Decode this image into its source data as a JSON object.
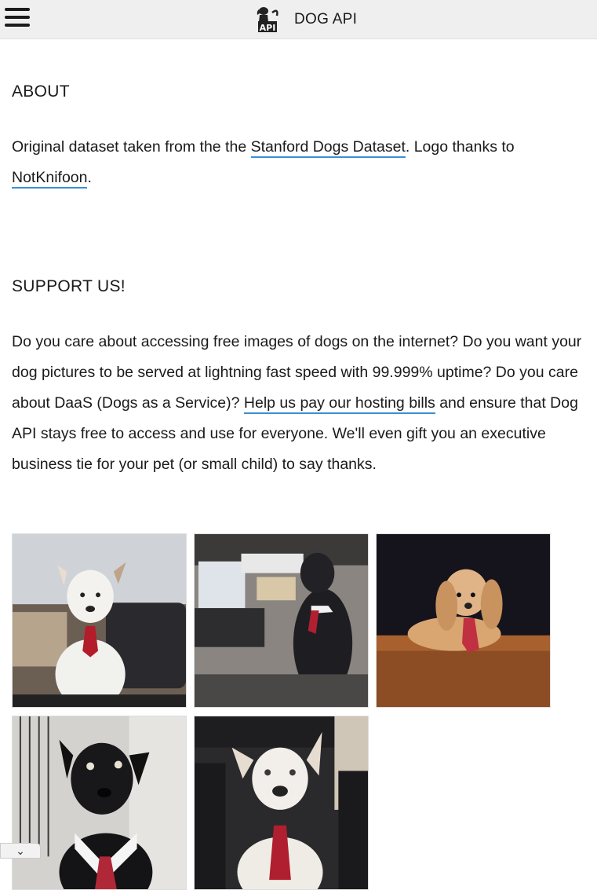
{
  "header": {
    "menu_icon": "hamburger-menu-icon",
    "logo_icon": "dog-api-logo-icon",
    "brand_name": "DOG API"
  },
  "about": {
    "heading": "ABOUT",
    "text_1": "Original dataset taken from the the ",
    "link_stanford": "Stanford Dogs Dataset",
    "text_2": ". Logo thanks to ",
    "link_notknifoon": "NotKnifoon",
    "text_3": "."
  },
  "support": {
    "heading": "SUPPORT US!",
    "text_1": "Do you care about accessing free images of dogs on the internet? Do you want your dog pictures to be served at lightning fast speed with 99.999% uptime? Do you care about DaaS (Dogs as a Service)? ",
    "link_help": "Help us pay our hosting bills",
    "text_2": " and ensure that Dog API stays free to access and use for everyone. We'll even gift you an executive business tie for your pet (or small child) to say thanks."
  },
  "gallery": {
    "images": [
      {
        "subject": "white dog with red tie on leather sofa"
      },
      {
        "subject": "black dog with tie beside laptop and keyboard"
      },
      {
        "subject": "long-haired dachshund with tie on wooden floor"
      },
      {
        "subject": "black dog with white collar and tie"
      },
      {
        "subject": "white dog with tie on black leather chair"
      }
    ]
  },
  "footer": {
    "chevron_icon": "chevron-down-icon"
  },
  "colors": {
    "header_bg": "#efefef",
    "link_underline": "#3b8fd4",
    "text": "#1a1a1a"
  }
}
